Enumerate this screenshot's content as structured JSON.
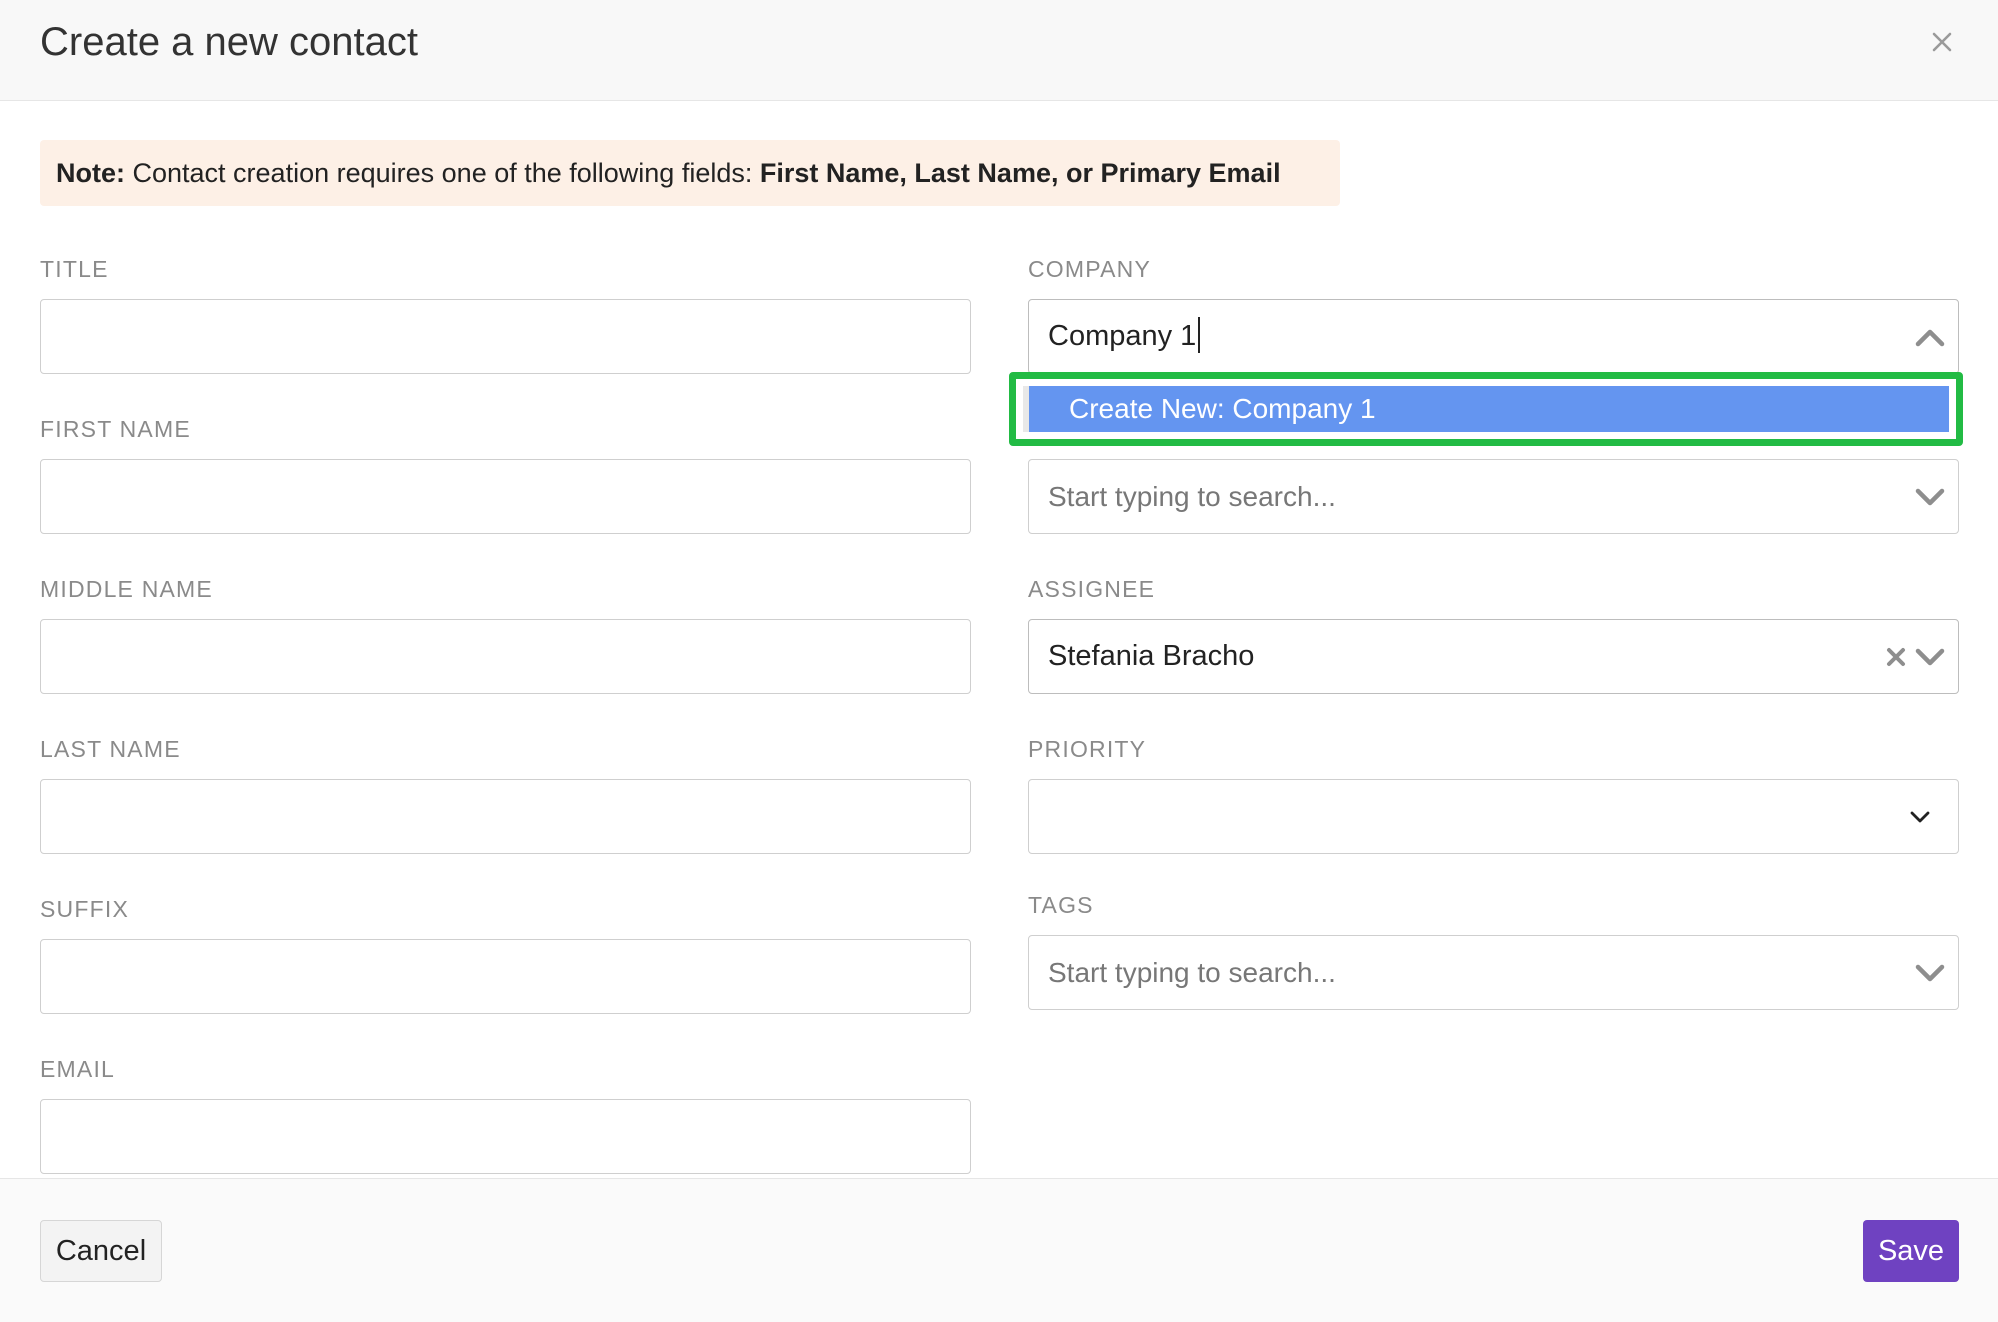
{
  "modal": {
    "title": "Create a new contact"
  },
  "note": {
    "prefix": "Note:",
    "text": " Contact creation requires one of the following fields: ",
    "fields": "First Name, Last Name, or Primary Email",
    "bg_color": "#fdf0e6"
  },
  "left_fields": {
    "title": {
      "label": "TITLE",
      "value": ""
    },
    "first_name": {
      "label": "FIRST NAME",
      "value": ""
    },
    "middle_name": {
      "label": "MIDDLE NAME",
      "value": ""
    },
    "last_name": {
      "label": "LAST NAME",
      "value": ""
    },
    "suffix": {
      "label": "SUFFIX",
      "value": ""
    },
    "email": {
      "label": "EMAIL",
      "value": ""
    }
  },
  "right_fields": {
    "company": {
      "label": "COMPANY",
      "value": "Company 1",
      "dropdown_open": true,
      "option": "Create New: Company 1"
    },
    "second_search": {
      "placeholder": "Start typing to search..."
    },
    "assignee": {
      "label": "ASSIGNEE",
      "value": "Stefania Bracho"
    },
    "priority": {
      "label": "PRIORITY",
      "value": ""
    },
    "tags": {
      "label": "TAGS",
      "placeholder": "Start typing to search..."
    }
  },
  "footer": {
    "cancel_label": "Cancel",
    "save_label": "Save"
  },
  "colors": {
    "accent": "#6f42c1",
    "option_highlight": "#6495f0",
    "focus_outline": "#22bb44"
  },
  "icons": {
    "close": "close-icon",
    "chevron_up": "chevron-up-icon",
    "chevron_down": "chevron-down-icon",
    "clear": "clear-icon"
  }
}
